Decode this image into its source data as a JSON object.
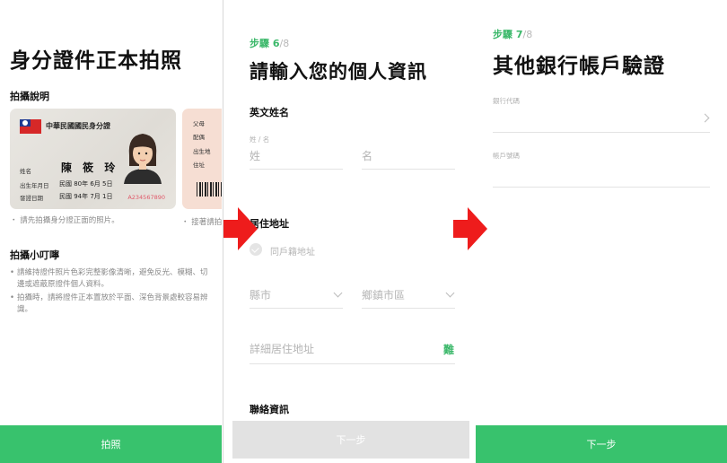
{
  "panel1": {
    "title": "身分證件正本拍照",
    "shoot_guide_heading": "拍攝說明",
    "card": {
      "header": "中華民國國民身分證",
      "name_label": "姓名",
      "name_value": "陳 筱 玲",
      "dob_label": "出生年月日",
      "dob_value": "民國 80年 6月 5日",
      "issue_label": "發證日期",
      "issue_value": "民國 94年 7月 1日",
      "id_number": "A234567890"
    },
    "back_card_labels": [
      "父母",
      "配偶",
      "出生地",
      "住址"
    ],
    "front_note": "・ 請先拍攝身分證正面的照片。",
    "back_note": "・ 接著請拍",
    "tips_heading": "拍攝小叮嚀",
    "tips": [
      "請維持證件照片色彩完整影像清晰，避免反光、模糊、切邊或遮蔽原證件個人資料。",
      "拍攝時，請將證件正本置放於平面、深色背景處較容易辨識。"
    ],
    "button_label": "拍照"
  },
  "panel2": {
    "step_current": "步驟 6",
    "step_total": "/8",
    "title": "請輸入您的個人資訊",
    "english_name_heading": "英文姓名",
    "surname_label": "姓 / 名",
    "surname_placeholder": "姓",
    "given_placeholder": "名",
    "address_heading": "居住地址",
    "same_as_registered": "同戶籍地址",
    "city_placeholder": "縣市",
    "district_placeholder": "鄉鎮市區",
    "detail_placeholder": "詳細居住地址",
    "rare_char_link": "難",
    "contact_heading": "聯絡資訊",
    "button_label": "下一步"
  },
  "panel3": {
    "step_current": "步驟 7",
    "step_total": "/8",
    "title": "其他銀行帳戶驗證",
    "bank_code_label": "銀行代碼",
    "account_label": "帳戶號碼",
    "button_label": "下一步"
  },
  "colors": {
    "brand_green": "#38c26d",
    "arrow_red": "#ee1c1c",
    "disabled_grey": "#e2e2e2"
  }
}
